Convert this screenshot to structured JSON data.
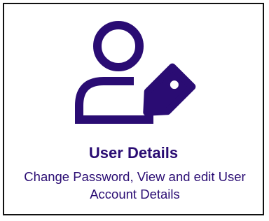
{
  "card": {
    "title": "User Details",
    "description": "Change Password, View and edit User Account Details",
    "icon": "user-tag-icon",
    "accent_color": "#2a0c73"
  }
}
